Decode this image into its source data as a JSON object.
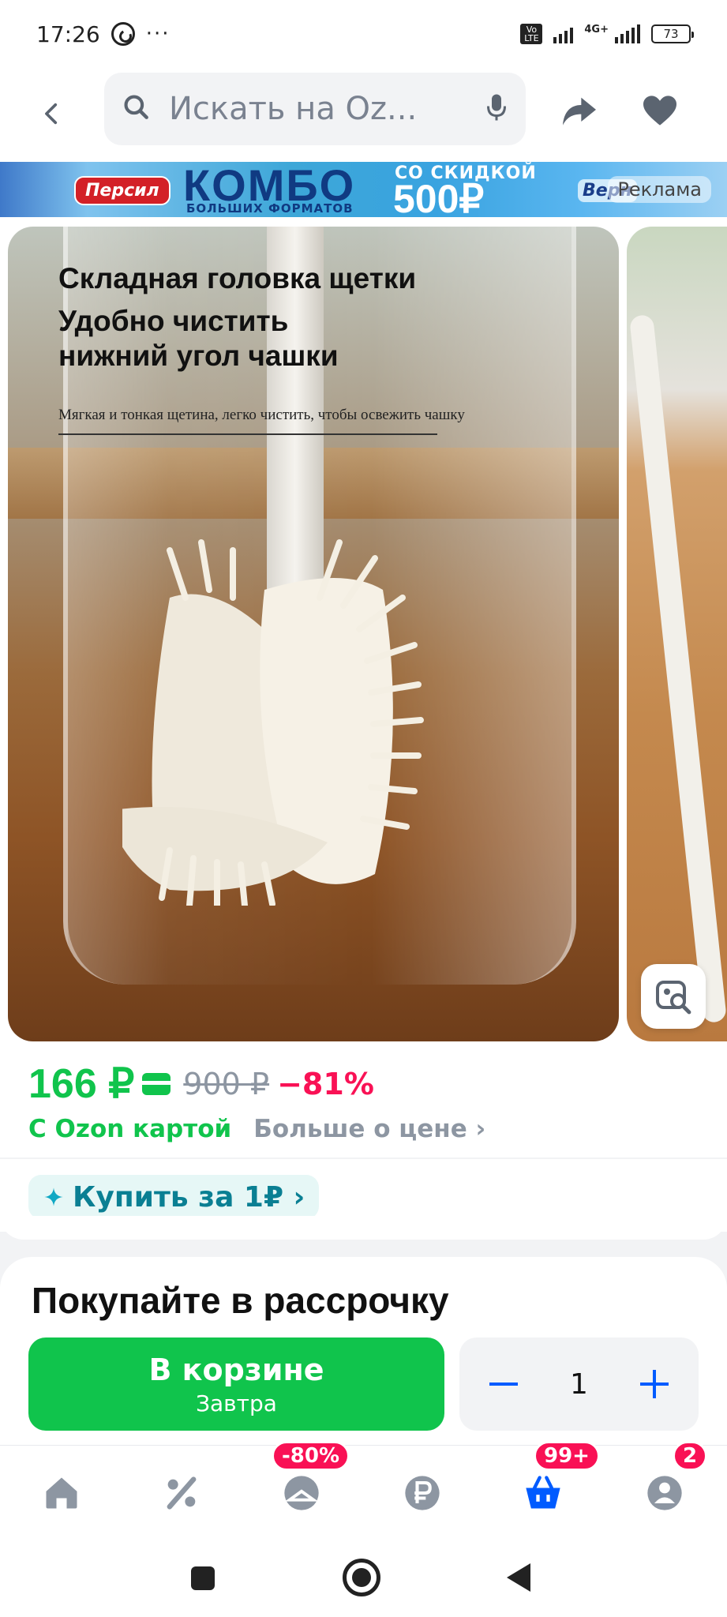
{
  "status_bar": {
    "time": "17:26",
    "dots": "···",
    "volte": "Vo LTE",
    "network": "4G+",
    "battery": "73"
  },
  "header": {
    "search_placeholder": "Искать на Oz..."
  },
  "ad": {
    "brand_left": "Персил",
    "headline": "КОМБО",
    "sub": "БОЛЬШИХ ФОРМАТОВ",
    "discount_top": "СО СКИДКОЙ",
    "discount": "500₽",
    "brand_right": "Верн",
    "label": "Реклама"
  },
  "product_image": {
    "title": "Складная головка щетки",
    "line2": "Удобно чистить",
    "line3": "нижний угол чашки",
    "caption": "Мягкая и тонкая щетина, легко чистить, чтобы освежить чашку"
  },
  "price": {
    "current": "166 ₽",
    "old": "900 ₽",
    "discount": "−81%",
    "card_label": "С Ozon картой",
    "more": "Больше о цене ›"
  },
  "promo": {
    "buy_for": "Купить за 1₽ ›"
  },
  "installments": {
    "title": "Покупайте в рассрочку"
  },
  "cart": {
    "button_label": "В корзине",
    "button_sub": "Завтра",
    "quantity": "1"
  },
  "bottom_nav": {
    "items": [
      {
        "name": "home"
      },
      {
        "name": "discounts"
      },
      {
        "name": "fresh",
        "badge": "-80%"
      },
      {
        "name": "finance"
      },
      {
        "name": "cart",
        "badge": "99+"
      },
      {
        "name": "profile",
        "badge": "2"
      }
    ]
  },
  "colors": {
    "accent_green": "#10c44c",
    "accent_blue": "#005bff",
    "accent_pink": "#f91155",
    "text_gray": "#8d96a2"
  }
}
